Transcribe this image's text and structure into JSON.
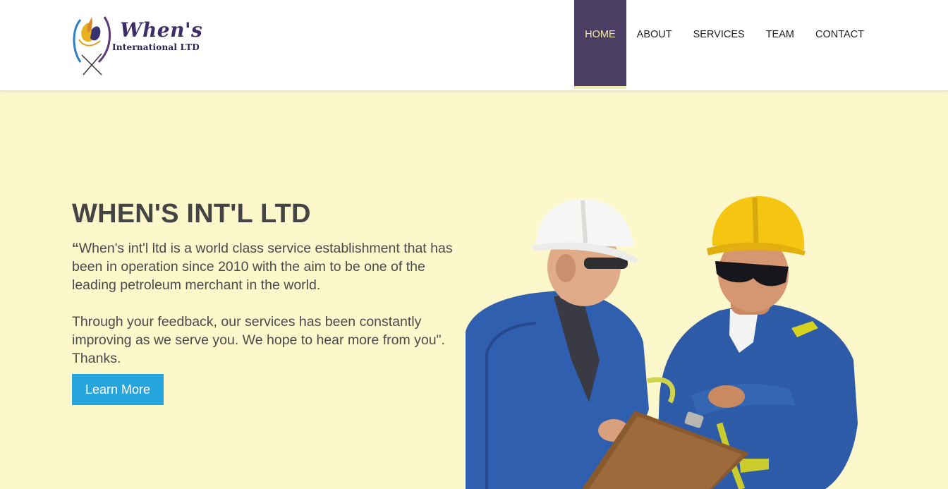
{
  "header": {
    "logo": {
      "title": "When's",
      "subtitle": "International LTD"
    },
    "nav": [
      {
        "label": "HOME",
        "active": true
      },
      {
        "label": "ABOUT",
        "active": false
      },
      {
        "label": "SERVICES",
        "active": false
      },
      {
        "label": "TEAM",
        "active": false
      },
      {
        "label": "CONTACT",
        "active": false
      }
    ]
  },
  "hero": {
    "title": "WHEN'S INT'L LTD",
    "quote_open": "“",
    "paragraph_1": "When's int'l ltd is a world class service establishment that has been in operation since 2010 with the aim to be one of the leading petroleum merchant in the world.",
    "paragraph_2": "Through your feedback, our services has been constantly improving as we serve you. We hope to hear more from you\". Thanks.",
    "button_label": "Learn More",
    "image_name": "two-workers-hard-hats-clipboard"
  },
  "colors": {
    "background": "#fdf8cc",
    "nav_active_bg": "#4a3f62",
    "nav_active_text": "#f3e79a",
    "button_bg": "#26a6dc",
    "heading": "#444444",
    "logo_text": "#3e2e68"
  }
}
